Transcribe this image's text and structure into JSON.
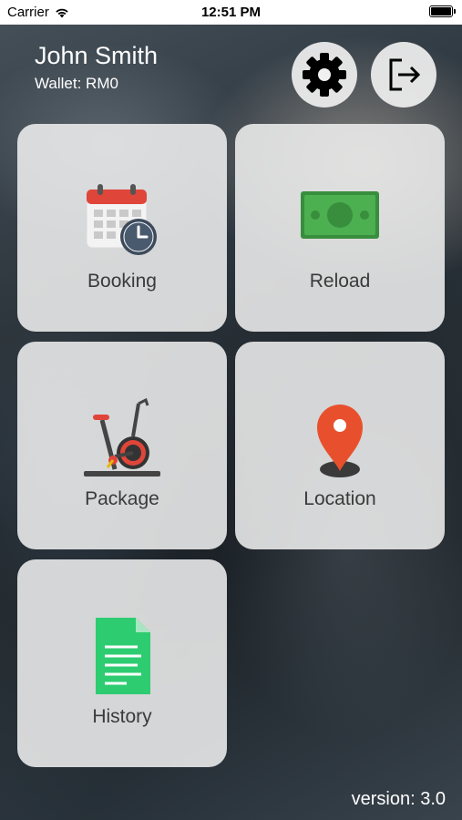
{
  "status_bar": {
    "carrier": "Carrier",
    "time": "12:51 PM",
    "icons": [
      "wifi-icon",
      "battery-icon"
    ]
  },
  "header": {
    "user_name": "John Smith",
    "wallet": "Wallet: RM0",
    "settings_icon": "gear-icon",
    "logout_icon": "logout-icon"
  },
  "menu": {
    "booking": {
      "label": "Booking",
      "icon": "calendar-clock-icon"
    },
    "reload": {
      "label": "Reload",
      "icon": "money-icon"
    },
    "package": {
      "label": "Package",
      "icon": "exercise-bike-icon"
    },
    "location": {
      "label": "Location",
      "icon": "map-pin-icon"
    },
    "history": {
      "label": "History",
      "icon": "document-icon"
    }
  },
  "footer": {
    "version": "version: 3.0"
  },
  "colors": {
    "tile_bg": "#eeeeee",
    "calendar_red": "#e0453a",
    "money_green": "#4caf50",
    "pin_orange": "#e8502d",
    "doc_green": "#2ecc71"
  }
}
